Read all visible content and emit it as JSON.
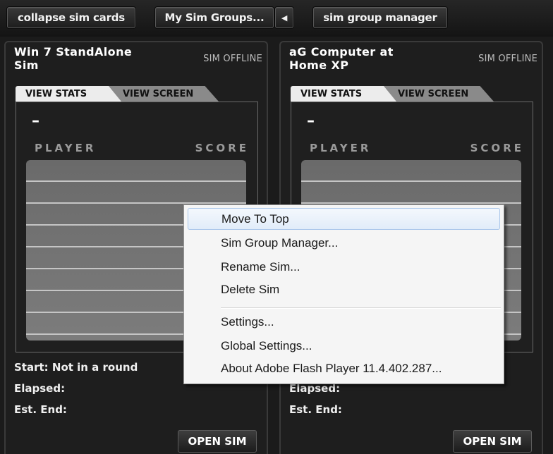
{
  "toolbar": {
    "collapse_label": "collapse sim cards",
    "groups_label": "My Sim Groups...",
    "arrow_label": "◀",
    "manager_label": "sim group manager"
  },
  "cards": [
    {
      "name_line1": "Win 7 StandAlone",
      "name_line2": "Sim",
      "status": "SIM OFFLINE",
      "tab_stats": "VIEW STATS",
      "tab_screen": "VIEW SCREEN",
      "dash": "–",
      "player_header": "PLAYER",
      "score_header": "SCORE",
      "start": "Start: Not in a round",
      "elapsed": "Elapsed:",
      "est_end": "Est. End:",
      "open_label": "OPEN SIM"
    },
    {
      "name_line1": "aG Computer at",
      "name_line2": "Home XP",
      "status": "SIM OFFLINE",
      "tab_stats": "VIEW STATS",
      "tab_screen": "VIEW SCREEN",
      "dash": "–",
      "player_header": "PLAYER",
      "score_header": "SCORE",
      "start": "",
      "elapsed": "Elapsed:",
      "est_end": "Est. End:",
      "open_label": "OPEN SIM"
    }
  ],
  "context_menu": {
    "items": [
      "Move To Top",
      "Sim Group Manager...",
      "Rename Sim...",
      "Delete Sim",
      "Settings...",
      "Global Settings...",
      "About Adobe Flash Player 11.4.402.287..."
    ],
    "highlighted_index": 0
  }
}
